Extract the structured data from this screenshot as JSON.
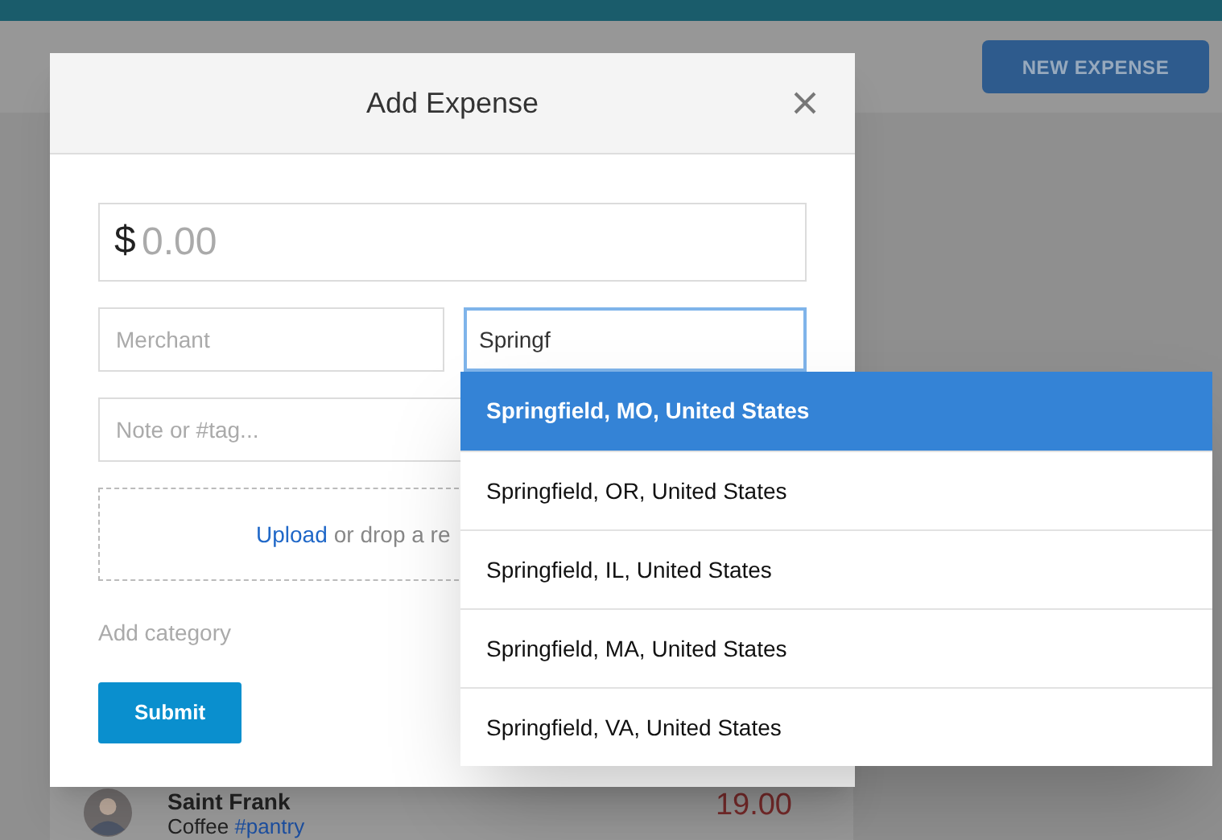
{
  "header": {
    "new_expense_button": "NEW EXPENSE"
  },
  "background_expense": {
    "name": "Saint Frank",
    "amount": "19.00",
    "note": "Coffee",
    "tag": "#pantry"
  },
  "modal": {
    "title": "Add Expense",
    "amount": {
      "currency": "$",
      "placeholder": "0.00"
    },
    "merchant": {
      "placeholder": "Merchant"
    },
    "location": {
      "value": "Springf"
    },
    "note": {
      "placeholder": "Note or #tag..."
    },
    "upload": {
      "link": "Upload",
      "text": "or drop a re"
    },
    "add_category": "Add category",
    "submit": "Submit"
  },
  "suggestions": [
    {
      "label": "Springfield, MO, United States",
      "selected": true
    },
    {
      "label": "Springfield, OR, United States",
      "selected": false
    },
    {
      "label": "Springfield, IL, United States",
      "selected": false
    },
    {
      "label": "Springfield, MA, United States",
      "selected": false
    },
    {
      "label": "Springfield, VA, United States",
      "selected": false
    }
  ]
}
